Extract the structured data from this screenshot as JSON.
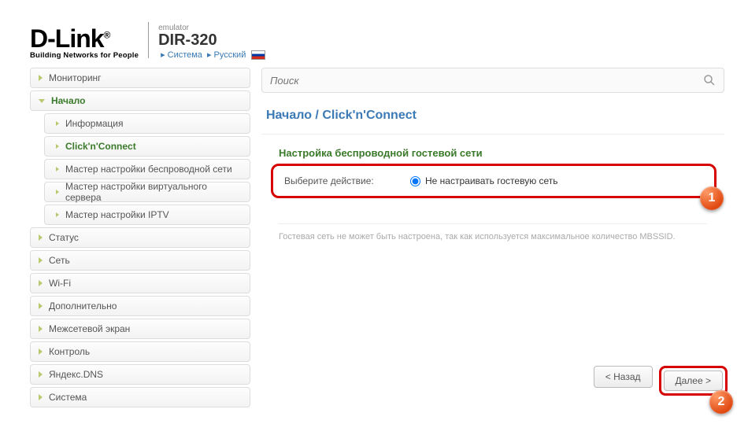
{
  "header": {
    "logo_main": "D-Link",
    "logo_reg": "®",
    "logo_sub": "Building Networks for People",
    "emulator": "emulator",
    "model": "DIR-320",
    "crumb_system": "Система",
    "crumb_lang": "Русский"
  },
  "sidebar": {
    "items": [
      {
        "label": "Мониторинг",
        "active": false,
        "expanded": false
      },
      {
        "label": "Начало",
        "active": true,
        "expanded": true
      },
      {
        "label": "Статус",
        "active": false,
        "expanded": false
      },
      {
        "label": "Сеть",
        "active": false,
        "expanded": false
      },
      {
        "label": "Wi-Fi",
        "active": false,
        "expanded": false
      },
      {
        "label": "Дополнительно",
        "active": false,
        "expanded": false
      },
      {
        "label": "Межсетевой экран",
        "active": false,
        "expanded": false
      },
      {
        "label": "Контроль",
        "active": false,
        "expanded": false
      },
      {
        "label": "Яндекс.DNS",
        "active": false,
        "expanded": false
      },
      {
        "label": "Система",
        "active": false,
        "expanded": false
      }
    ],
    "subitems": [
      {
        "label": "Информация",
        "active": false
      },
      {
        "label": "Click'n'Connect",
        "active": true
      },
      {
        "label": "Мастер настройки беспроводной сети",
        "active": false
      },
      {
        "label": "Мастер настройки виртуального сервера",
        "active": false
      },
      {
        "label": "Мастер настройки IPTV",
        "active": false
      }
    ]
  },
  "search": {
    "placeholder": "Поиск"
  },
  "main": {
    "breadcrumb_root": "Начало",
    "breadcrumb_sep": "/",
    "breadcrumb_page": "Click'n'Connect",
    "section_title": "Настройка беспроводной гостевой сети",
    "action_label": "Выберите действие:",
    "radio_option": "Не настраивать гостевую сеть",
    "hint": "Гостевая сеть не может быть настроена, так как используется максимальное количество MBSSID."
  },
  "footer": {
    "back": "< Назад",
    "next": "Далее >"
  },
  "callouts": {
    "one": "1",
    "two": "2"
  }
}
